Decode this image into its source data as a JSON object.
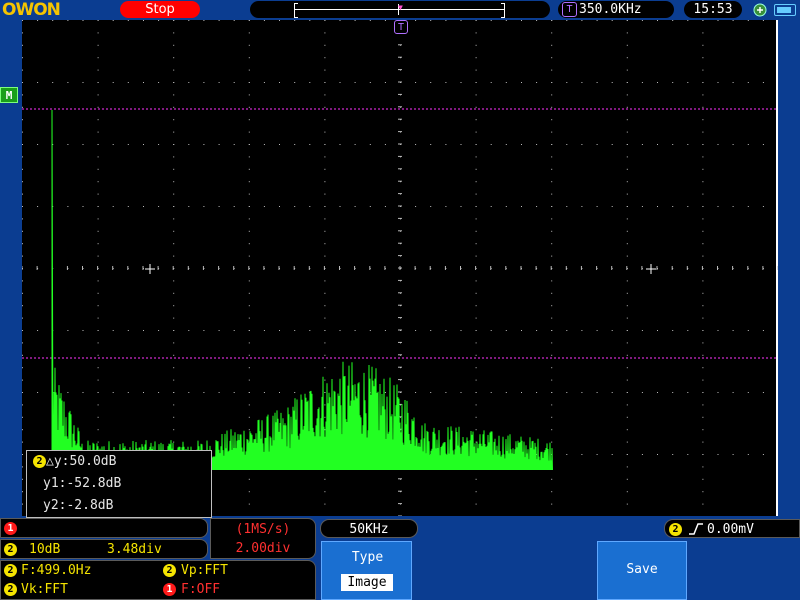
{
  "top": {
    "logo": "OWON",
    "run_state": "Stop",
    "trigger_freq": "350.0KHz",
    "trigger_icon": "T",
    "clock": "15:53"
  },
  "screen": {
    "channel_marker": "M",
    "trigger_marker": "T",
    "waveform_color": "#22ff22",
    "cursor_color": "#ff33ff",
    "grid_color": "#bbbbbb"
  },
  "cursor_readout": {
    "delta_y": "△y:50.0dB",
    "y1": "y1:-52.8dB",
    "y2": "y2:-2.8dB",
    "channel": "2"
  },
  "status": {
    "ch1_num": "1",
    "ch2_num": "2",
    "ch2_scale": "10dB",
    "ch2_offset": "3.48div",
    "sample_rate": "(1MS/s)",
    "sample_div": "2.00div",
    "horizontal_scale": "50KHz",
    "trigger_channel": "2",
    "trigger_level": "0.00mV",
    "meas_freq": "F:499.0Hz",
    "meas_vp": "Vp:FFT",
    "meas_vk": "Vk:FFT",
    "meas_f1": "F:OFF"
  },
  "menu": {
    "type_label": "Type",
    "type_value": "Image",
    "save_label": "Save"
  }
}
